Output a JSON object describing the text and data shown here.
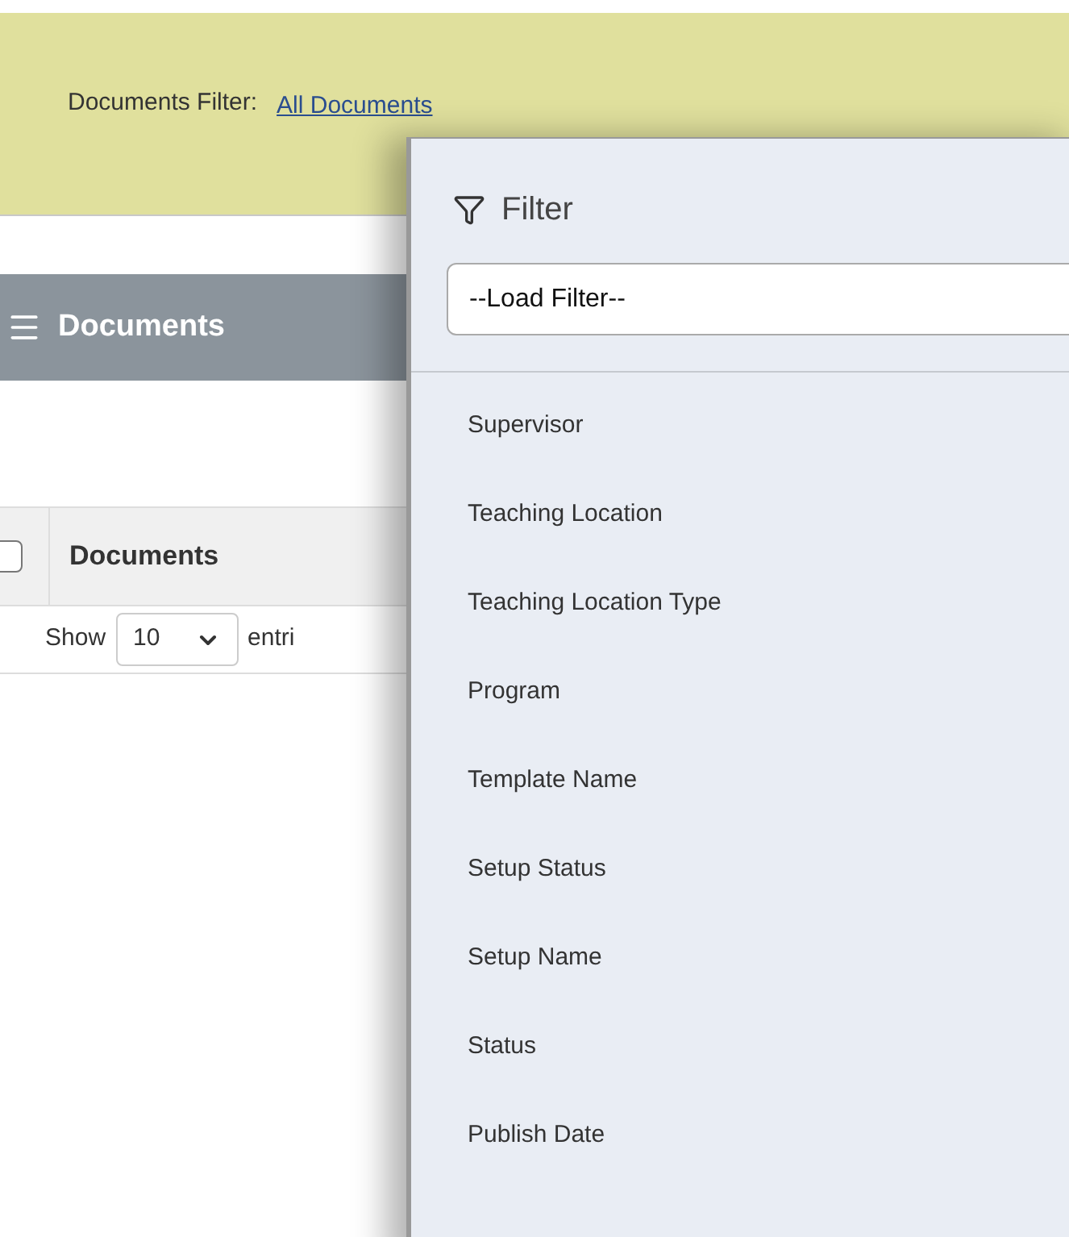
{
  "header": {
    "label": "Documents Filter:",
    "link": "All Documents"
  },
  "panel_title": "Documents",
  "table": {
    "select_all": {
      "checked": false
    },
    "columns": [
      "Documents"
    ]
  },
  "length_control": {
    "show": "Show",
    "value": "10",
    "entries": "entri"
  },
  "filter_panel": {
    "title": "Filter",
    "load_filter": "--Load Filter--",
    "fields": [
      "Supervisor",
      "Teaching Location",
      "Teaching Location Type",
      "Program",
      "Template Name",
      "Setup Status",
      "Setup Name",
      "Status",
      "Publish Date"
    ]
  }
}
